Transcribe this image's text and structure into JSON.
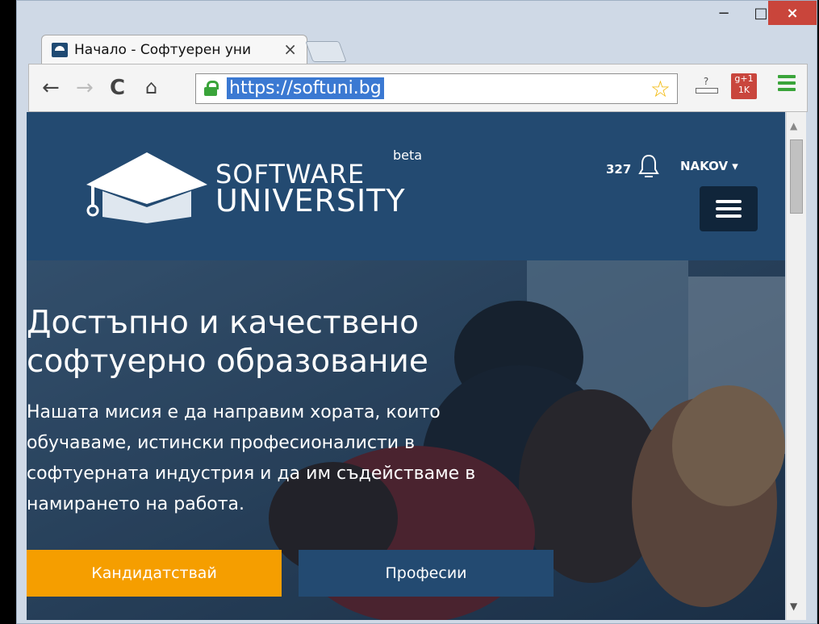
{
  "browser": {
    "tab_title": "Начало - Софтуерен уни",
    "tab_close": "×",
    "window_controls": {
      "minimize": "−",
      "maximize": "□",
      "close": "×"
    },
    "nav": {
      "back": "←",
      "forward": "→",
      "reload": "C",
      "home": "⌂"
    },
    "url": "https://softuni.bg",
    "star": "☆",
    "download_label": "?",
    "gplus_label": "g+1 1K"
  },
  "site": {
    "logo_line1": "SOFTWARE",
    "logo_line2": "UNIVERSITY",
    "beta": "beta",
    "notifications_count": "327",
    "username": "NAKOV ▾",
    "hero_title_line1": "Достъпно и качествено",
    "hero_title_line2": "софтуерно образование",
    "hero_text": "Нашата мисия е да направим хората, които обучаваме, истински професионалисти в софтуерната индустрия и да им съдействаме в намирането на работа.",
    "btn_apply": "Кандидатствай",
    "btn_professions": "Професии"
  },
  "colors": {
    "header_bg": "#234a71",
    "accent": "#f59e00",
    "hero_dark": "#10253a"
  },
  "icons": {
    "lock": "lock-icon",
    "star": "star-icon",
    "bell": "bell-icon",
    "menu": "hamburger-icon"
  }
}
